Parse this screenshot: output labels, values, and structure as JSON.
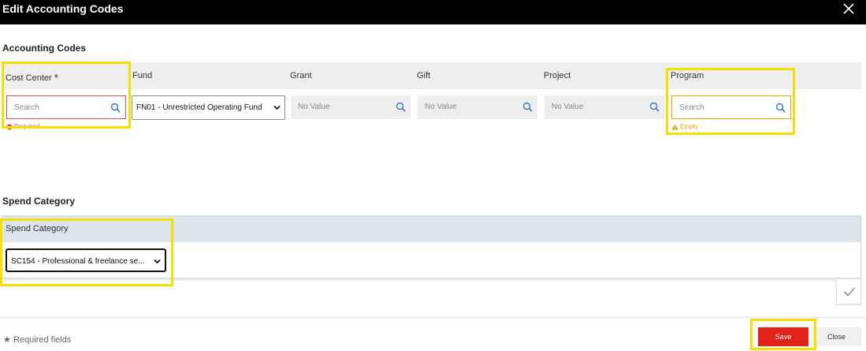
{
  "dialog": {
    "title": "Edit Accounting Codes"
  },
  "accounting": {
    "section_title": "Accounting Codes",
    "columns": [
      {
        "label": "Cost Center",
        "required_mark": "*",
        "placeholder": "Search",
        "hint": "Required"
      },
      {
        "label": "Fund",
        "value": "FN01 - Unrestricted Operating Fund"
      },
      {
        "label": "Grant",
        "value": "No Value"
      },
      {
        "label": "Gift",
        "value": "No Value"
      },
      {
        "label": "Project",
        "value": "No Value"
      },
      {
        "label": "Program",
        "placeholder": "Search",
        "hint": "Empty"
      }
    ]
  },
  "spend": {
    "section_title": "Spend Category",
    "column_label": "Spend Category",
    "value": "SC154 - Professional & freelance se..."
  },
  "footer": {
    "required_note": "Required fields",
    "save_label": "Save",
    "close_label": "Close"
  },
  "colors": {
    "title_bar": "#000000",
    "save_button": "#e2231a",
    "required_error": "#d9534f",
    "empty_warning": "#e8a200",
    "annotation_highlight": "#f5e000"
  },
  "icons": [
    "close-icon",
    "search-icon",
    "chevron-down-icon",
    "error-icon",
    "warning-icon",
    "checkmark-icon",
    "star-icon"
  ]
}
